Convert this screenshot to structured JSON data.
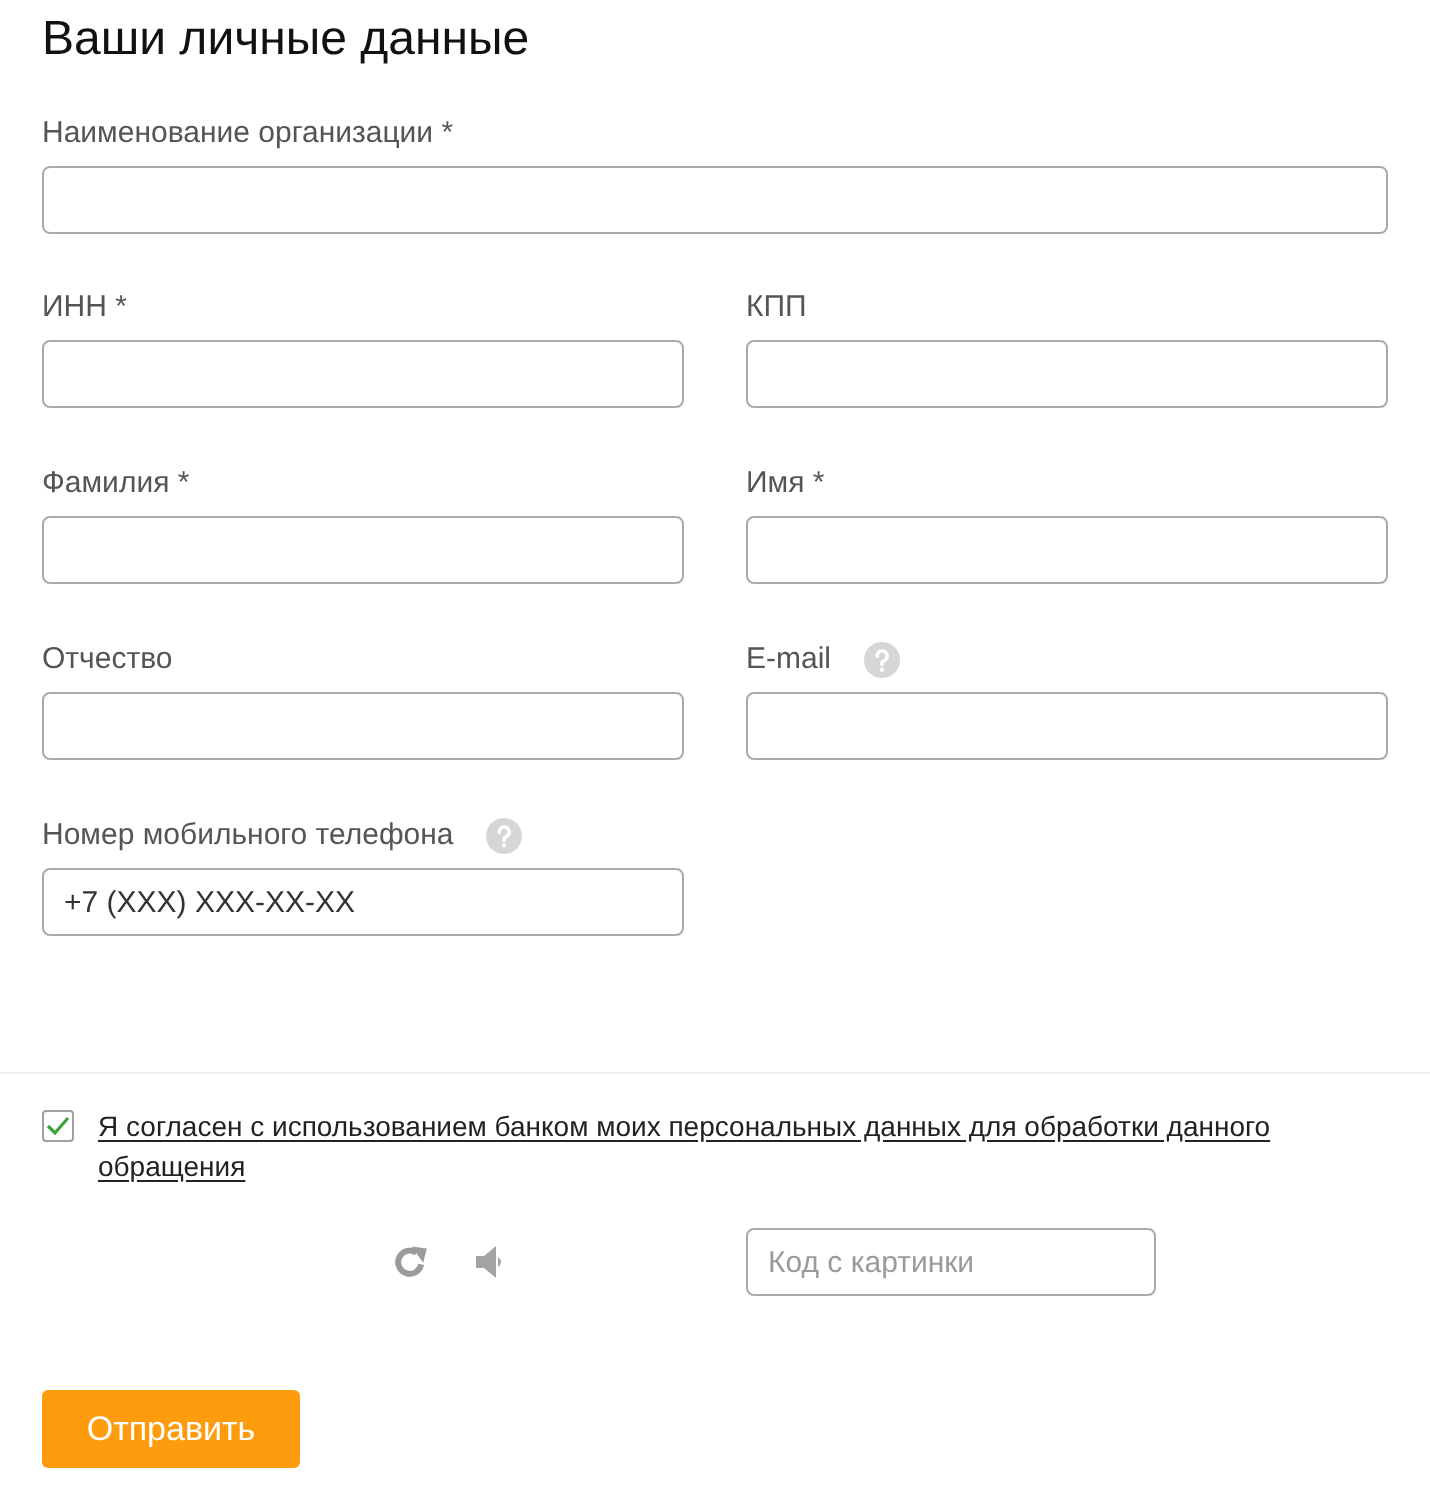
{
  "heading": "Ваши личные данные",
  "organization_field": {
    "label": "Наименование организации *",
    "help": false
  },
  "fields": [
    {
      "label": "ИНН *",
      "help": false
    },
    {
      "label": "КПП",
      "help": false
    },
    {
      "label": "Фамилия *",
      "help": false
    },
    {
      "label": "Имя *",
      "help": false
    },
    {
      "label": "Отчество",
      "help": false
    },
    {
      "label": "E-mail",
      "help": true
    },
    {
      "label": "Номер мобильного телефона",
      "help": true,
      "value": "+7 (XXX) XXX-XX-XX"
    }
  ],
  "consent": {
    "checked": true,
    "text": "Я согласен с использованием банком моих персональных данных для обработки данного обращения"
  },
  "captcha": {
    "placeholder": "Код с картинки"
  },
  "submit_button": {
    "label": "Отправить"
  }
}
